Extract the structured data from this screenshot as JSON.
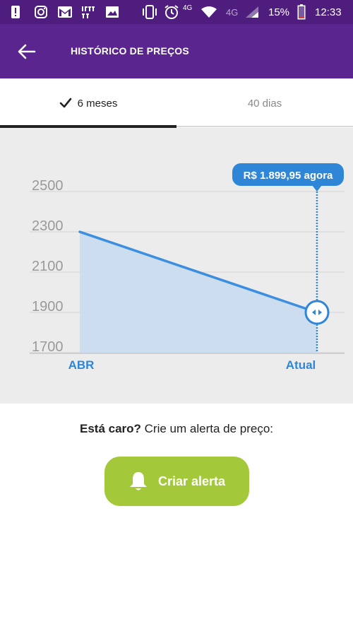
{
  "status_bar": {
    "network_label": "4G",
    "signal_label": "4G",
    "battery": "15%",
    "time": "12:33",
    "icons": [
      "alert-icon",
      "instagram-icon",
      "gmail-icon",
      "ifttt-icon",
      "image-icon",
      "vibrate-icon",
      "alarm-icon",
      "wifi-icon",
      "signal-icon",
      "battery-icon"
    ]
  },
  "app_bar": {
    "title": "HISTÓRICO DE PREÇOS",
    "back_icon": "arrow-left-icon"
  },
  "tabs": [
    {
      "label": "6 meses",
      "selected": true
    },
    {
      "label": "40 dias",
      "selected": false
    }
  ],
  "chart_data": {
    "type": "area",
    "x": [
      "ABR",
      "Atual"
    ],
    "values": [
      2300,
      1899.95
    ],
    "y_ticks": [
      "2500",
      "2300",
      "2100",
      "1900",
      "1700"
    ],
    "ylim": [
      1700,
      2500
    ],
    "grid": true,
    "tooltip": "R$ 1.899,95 agora",
    "colors": {
      "line": "#3b8ee0",
      "fill": "#c9dcee",
      "tick_label": "#2f86d6",
      "tooltip_bg": "#2f86d6"
    }
  },
  "alert_section": {
    "prompt_bold": "Está caro?",
    "prompt_rest": " Crie um alerta de preço:",
    "button_label": "Criar alerta",
    "button_color": "#a3c93a"
  }
}
